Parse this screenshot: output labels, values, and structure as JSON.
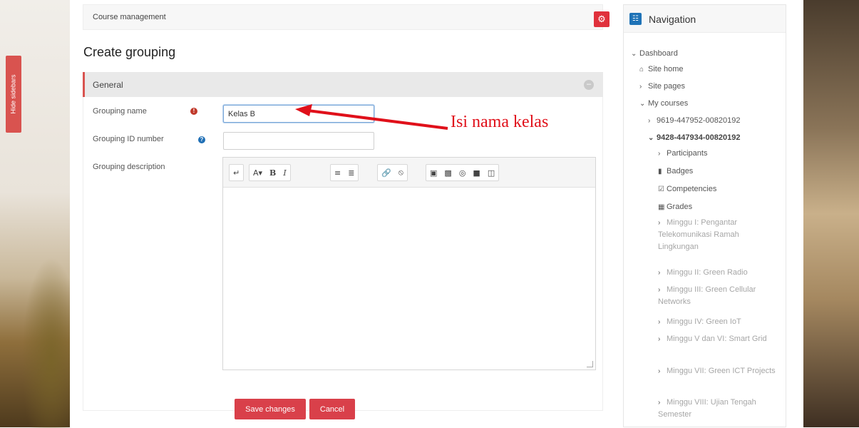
{
  "sidebar_toggle": {
    "label": "Hide sidebars"
  },
  "header": {
    "course_management_label": "Course management"
  },
  "page": {
    "title": "Create grouping"
  },
  "form": {
    "section_label": "General",
    "grouping_name_label": "Grouping name",
    "grouping_name_value": "Kelas B",
    "grouping_id_label": "Grouping ID number",
    "grouping_id_value": "",
    "description_label": "Grouping description",
    "save_label": "Save changes",
    "cancel_label": "Cancel"
  },
  "annotation": {
    "text": "Isi nama kelas"
  },
  "navigation": {
    "title": "Navigation",
    "dashboard": "Dashboard",
    "site_home": "Site home",
    "site_pages": "Site pages",
    "my_courses": "My courses",
    "course_1": "9619-447952-00820192",
    "course_2": "9428-447934-00820192",
    "participants": "Participants",
    "badges": "Badges",
    "competencies": "Competencies",
    "grades": "Grades",
    "week_1": "Minggu I: Pengantar Telekomunikasi Ramah Lingkungan",
    "week_2": "Minggu II: Green Radio",
    "week_3": "Minggu III: Green Cellular Networks",
    "week_4": "Minggu IV: Green IoT",
    "week_5": "Minggu V dan VI: Smart Grid",
    "week_6": "Minggu VII: Green ICT Projects",
    "week_7": "Minggu VIII: Ujian Tengah Semester"
  },
  "colors": {
    "accent": "#d9404a",
    "nav_icon": "#1f73b7",
    "annotation": "#e0101a"
  }
}
